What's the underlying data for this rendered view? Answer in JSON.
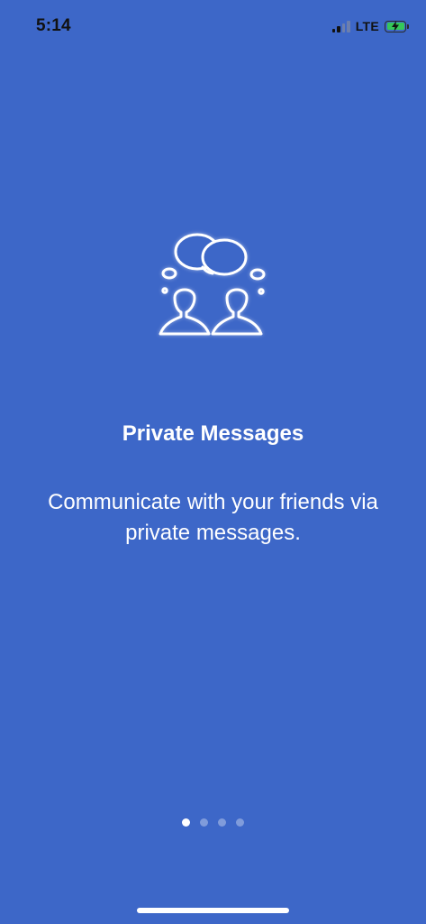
{
  "status_bar": {
    "time": "5:14",
    "network": "LTE",
    "signal_bars_strong": 2,
    "signal_bars_total": 4,
    "battery_color": "#35C759",
    "battery_charging": true
  },
  "onboarding": {
    "icon": "two-people-chat-icon",
    "title": "Private Messages",
    "description": "Communicate with your friends via private messages.",
    "pager": {
      "current_page": 1,
      "total_pages": 4
    }
  },
  "colors": {
    "background": "#3D67C8",
    "text": "#FFFFFF"
  }
}
